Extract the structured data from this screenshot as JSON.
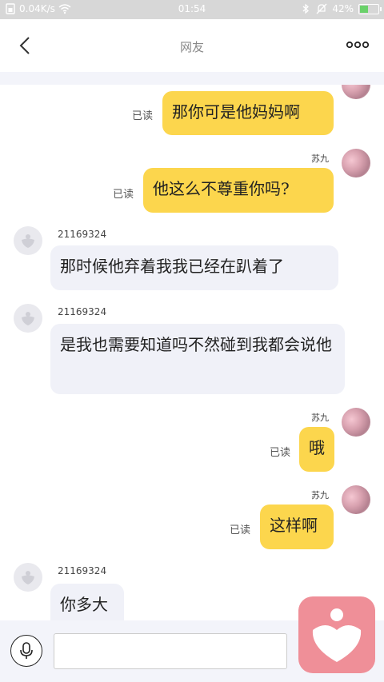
{
  "status_bar": {
    "net_speed": "0.04K/s",
    "time": "01:54",
    "battery": "42%",
    "battery_level": 0.42,
    "icons": [
      "sim-icon",
      "wifi-icon",
      "bluetooth-icon",
      "mute-icon",
      "battery-icon"
    ]
  },
  "header": {
    "title": "网友",
    "back_icon": "chevron-left-icon",
    "more_icon": "more-dots-icon"
  },
  "messages": [
    {
      "side": "mine",
      "sender": "",
      "text": "那你可是他妈妈啊",
      "read": "已读"
    },
    {
      "side": "mine",
      "sender": "苏九",
      "text": "他这么不尊重你吗?",
      "read": "已读"
    },
    {
      "side": "theirs",
      "sender": "21169324",
      "text": "那时候他弃着我我已经在趴着了"
    },
    {
      "side": "theirs",
      "sender": "21169324",
      "text": "是我也需要知道吗不然碰到我都会说他"
    },
    {
      "side": "mine",
      "sender": "苏九",
      "text": "哦",
      "read": "已读"
    },
    {
      "side": "mine",
      "sender": "苏九",
      "text": "这样啊",
      "read": "已读"
    },
    {
      "side": "theirs",
      "sender": "21169324",
      "text": "你多大"
    }
  ],
  "input": {
    "value": "",
    "placeholder": "",
    "mic_icon": "microphone-icon"
  },
  "fab": {
    "icon": "heart-person-icon"
  },
  "colors": {
    "my_bubble": "#fcd64d",
    "their_bubble": "#f0f1f8",
    "fab": "#ef8f98",
    "status_bar": "#d7d7d7"
  }
}
